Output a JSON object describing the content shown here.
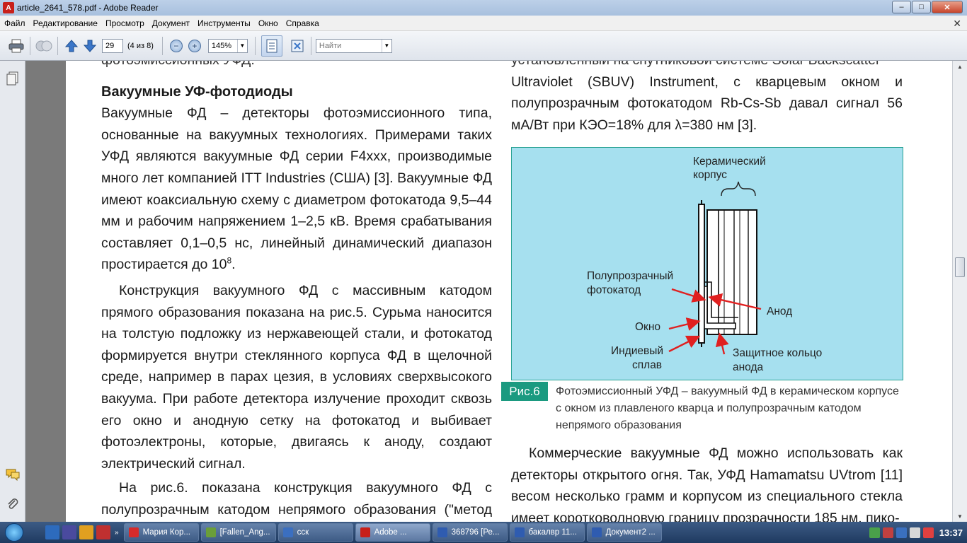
{
  "window": {
    "title": "article_2641_578.pdf - Adobe Reader",
    "app_icon": "pdf-icon",
    "minimize": "–",
    "maximize": "□",
    "close": "✕"
  },
  "menu": {
    "items": [
      "Файл",
      "Редактирование",
      "Просмотр",
      "Документ",
      "Инструменты",
      "Окно",
      "Справка"
    ],
    "close_glyph": "✕"
  },
  "toolbar": {
    "page_number": "29",
    "page_of": "(4 из 8)",
    "zoom": "145%",
    "search_placeholder": "Найти"
  },
  "left_column": {
    "cut_line": "фотоэмиссионных УФД.",
    "heading": "Вакуумные УФ-фотодиоды",
    "p1": "Вакуумные ФД – детекторы фотоэмиссионного типа, основанные на вакуумных технологиях. Примерами таких УФД являются вакуумные ФД серии F4xxx, производимые много лет компанией ITT Industries (США) [3]. Вакуумные ФД имеют коаксиальную схему с диаметром фотокатода 9,5–44 мм и рабочим напряжением 1–2,5 кВ. Время срабатывания составляет 0,1–0,5 нс, линейный динамический диапазон простирается до 10",
    "p1_sup": "8",
    "p1_end": ".",
    "p2": "Конструкция вакуумного ФД с массивным катодом прямого образования показана на рис.5. Сурьма наносится на толстую подложку из нержавеющей стали, и фотокатод формируется внутри стеклянного корпуса ФД в щелочной среде, например в парах цезия, в условиях сверхвысокого вакуума. При работе детектора излучение проходит сквозь его окно и анодную сетку на фотокатод и выбивает фотоэлектроны, которые, двигаясь к аноду, создают электрический сигнал.",
    "p3": "На рис.6. показана конструкция вакуумного ФД с полупрозрачным катодом непрямого образования (\"метод переноса\"). В этом случае тонкий фотокатод изготавливается отдельно"
  },
  "right_column": {
    "cut_line": "установленный на спутниковой системе Solar Backscatter",
    "p1": "Ultraviolet (SBUV) Instrument, с кварцевым окном и полупрозрачным фотокатодом Rb-Cs-Sb давал сигнал 56 мА/Вт при КЭО=18% для λ=380 нм [3].",
    "p2": "Коммерческие вакуумные ФД можно использовать как детекторы открытого огня. Так, УФД Hamamatsu UVtrom [11] весом несколько грамм и корпусом из специального стекла имеет коротковолновую границу прозрачности 185 нм, пико-"
  },
  "figure": {
    "label_ceramic_1": "Керамический",
    "label_ceramic_2": "корпус",
    "label_photocathode_1": "Полупрозрачный",
    "label_photocathode_2": "фотокатод",
    "label_anode": "Анод",
    "label_window": "Окно",
    "label_indium_1": "Индиевый",
    "label_indium_2": "сплав",
    "label_guard_1": "Защитное кольцо",
    "label_guard_2": "анода",
    "caption_badge": "Рис.6",
    "caption_text": "Фотоэмиссионный УФД – вакуумный ФД в керамическом корпусе с окном из плавленого кварца и полупрозрачным катодом непрямого образования",
    "arrow_color": "#e02020",
    "bg_color": "#a6e0ef"
  },
  "taskbar": {
    "tasks": [
      {
        "label": "Мария Кор...",
        "color": "#d62b2b"
      },
      {
        "label": "[Fallen_Ang...",
        "color": "#6a9e3a"
      },
      {
        "label": "сск",
        "color": "#3b6fc0"
      },
      {
        "label": "Adobe ...",
        "color": "#c8201a"
      },
      {
        "label": "368796 [Ре...",
        "color": "#2f5cb0"
      },
      {
        "label": "бакалвр 11...",
        "color": "#2f5cb0"
      },
      {
        "label": "Документ2 ...",
        "color": "#2f5cb0"
      }
    ],
    "clock": "13:37"
  }
}
